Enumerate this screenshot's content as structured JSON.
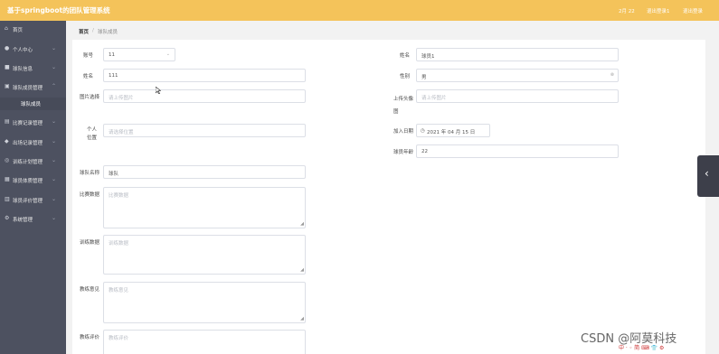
{
  "header": {
    "title": "基于springboot的团队管理系统",
    "links": [
      "2月 22",
      "退出登录1",
      "退出登录"
    ]
  },
  "sidebar": {
    "items": [
      {
        "label": "首页",
        "icon": "home-icon",
        "expandable": false
      },
      {
        "label": "个人中心",
        "icon": "user-icon",
        "expandable": true
      },
      {
        "label": "球队信息",
        "icon": "team-icon",
        "expandable": true
      },
      {
        "label": "球队成员管理",
        "icon": "member-icon",
        "expandable": true
      },
      {
        "label": "比赛记录管理",
        "icon": "record-icon",
        "expandable": true
      },
      {
        "label": "出场记录管理",
        "icon": "appearance-icon",
        "expandable": true
      },
      {
        "label": "训练计划管理",
        "icon": "training-icon",
        "expandable": true
      },
      {
        "label": "球员体质管理",
        "icon": "fitness-icon",
        "expandable": true
      },
      {
        "label": "球员评价管理",
        "icon": "review-icon",
        "expandable": true
      },
      {
        "label": "系统管理",
        "icon": "settings-icon",
        "expandable": true
      }
    ],
    "sub_item": "球队成员"
  },
  "breadcrumb": {
    "home": "首页",
    "separator": "/",
    "current": "球队成员"
  },
  "form": {
    "left": [
      {
        "label": "账号",
        "value": "11"
      },
      {
        "label": "姓名",
        "value": "111"
      },
      {
        "label": "图片选择",
        "placeholder": "请上传图片"
      }
    ],
    "right": [
      {
        "label": "姓名",
        "value": "球员1"
      },
      {
        "label": "性别",
        "value": "男"
      },
      {
        "label": "上传头像图",
        "placeholder": "请上传图片"
      }
    ],
    "position_label": "个人位置",
    "position_placeholder": "请选择位置",
    "join_date_label": "加入日期",
    "join_date_value": "2021 年 04 月 15 日",
    "age_label": "球员年龄",
    "age_value": "22",
    "team_label": "球队名称",
    "team_value": "球队",
    "textareas": [
      {
        "label": "比赛数据",
        "placeholder": "比赛数据"
      },
      {
        "label": "训练数据",
        "placeholder": "训练数据"
      },
      {
        "label": "教练意见",
        "placeholder": "教练意见"
      },
      {
        "label": "教练评价",
        "placeholder": "教练评价"
      }
    ]
  },
  "watermark": "CSDN @阿莫科技",
  "ime_text": "中 · ◦ 简 ⌨ 👕 ⚙"
}
